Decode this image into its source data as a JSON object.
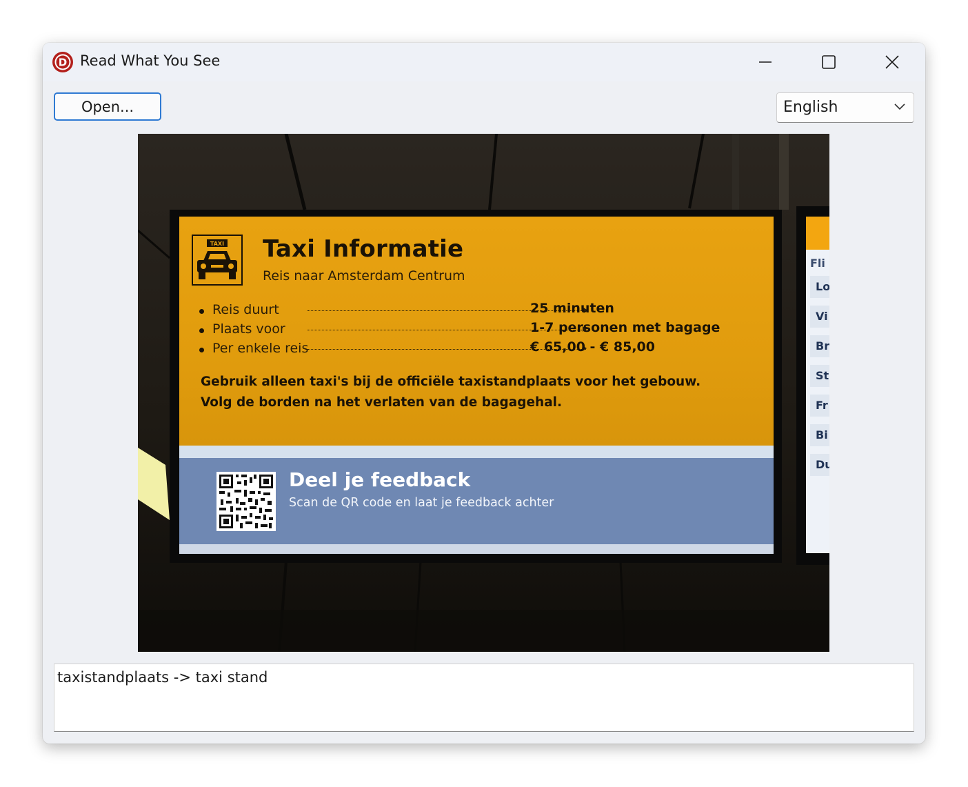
{
  "window": {
    "title": "Read What You See",
    "app_icon_letter": "D",
    "controls": [
      "minimize",
      "maximize",
      "close"
    ]
  },
  "toolbar": {
    "open_label": "Open...",
    "language": "English"
  },
  "photo": {
    "sign": {
      "title": "Taxi Informatie",
      "subtitle": "Reis naar Amsterdam Centrum",
      "taxi_label": "TAXI",
      "rows": [
        {
          "label": "Reis duurt",
          "value": "25 minuten"
        },
        {
          "label": "Plaats voor",
          "value": "1-7 personen met bagage"
        },
        {
          "label": "Per enkele reis",
          "value": "€ 65,00 - € 85,00"
        }
      ],
      "note": "Gebruik alleen taxi's bij de officiële taxistandplaats voor het gebouw. Volg de borden na het verlaten van de bagagehal.",
      "feedback_title": "Deel je feedback",
      "feedback_sub": "Scan de QR code en laat je feedback achter"
    },
    "side_sign": {
      "items": [
        "Fli",
        "Lo",
        "Vi",
        "Br",
        "St",
        "Fr",
        "Bi",
        "Du"
      ]
    }
  },
  "output": {
    "text": "taxistandplaats -> taxi stand"
  },
  "colors": {
    "accent": "#2f7ad3",
    "sign_orange": "#e8a211",
    "sign_blue": "#6f88b3",
    "app_icon": "#b3201c"
  }
}
